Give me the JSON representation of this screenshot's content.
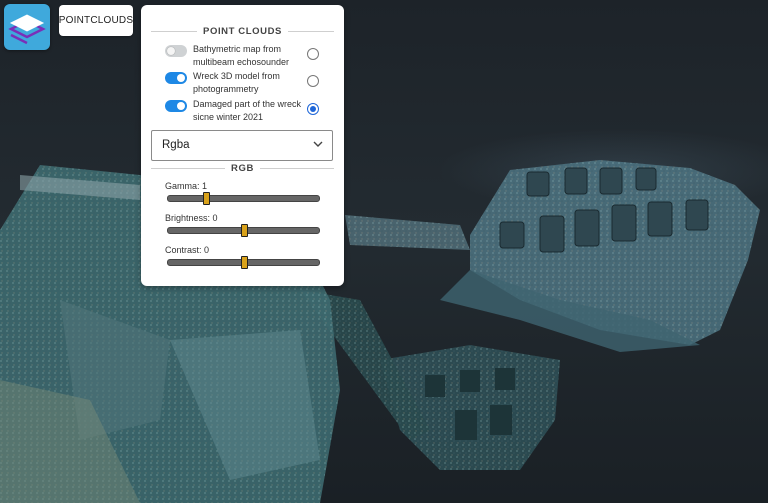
{
  "toolbar": {
    "tab_label": "POINTCLOUDS"
  },
  "panel": {
    "title": "POINT CLOUDS",
    "layers": [
      {
        "label": "Bathymetric map from multibeam echosounder",
        "toggle_on": false,
        "selected": false
      },
      {
        "label": "Wreck 3D model from photogrammetry",
        "toggle_on": true,
        "selected": false
      },
      {
        "label": "Damaged part of the wreck sicne winter 2021",
        "toggle_on": true,
        "selected": true
      }
    ],
    "color_mode": "Rgba",
    "rgb_section_title": "RGB",
    "sliders": [
      {
        "label": "Gamma: 1",
        "value": 1,
        "position": 0.25
      },
      {
        "label": "Brightness: 0",
        "value": 0,
        "position": 0.5
      },
      {
        "label": "Contrast: 0",
        "value": 0,
        "position": 0.5
      }
    ]
  },
  "colors": {
    "accent": "#1e88e5",
    "logo_bg": "#3fa9dc",
    "slider_thumb": "#d9a21b"
  },
  "icons": {
    "logo": "layers-icon",
    "select_arrow": "chevron-down-icon"
  }
}
